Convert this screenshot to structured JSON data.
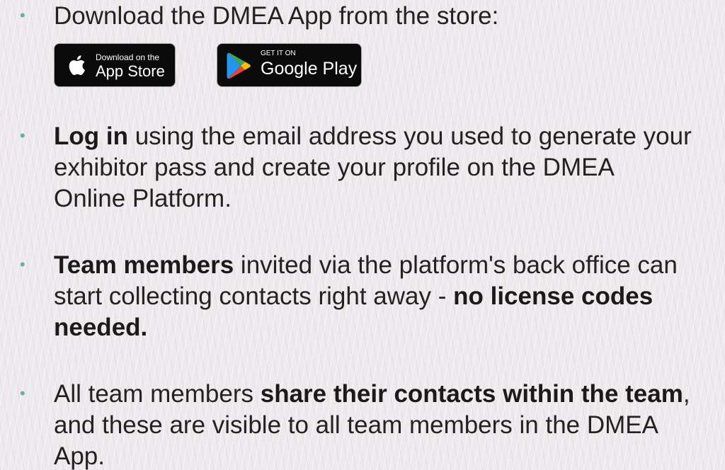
{
  "bullets": [
    {
      "parts": [
        "Download the DMEA App from the store:"
      ]
    },
    {
      "line1_bold": "Log in",
      "line1_rest": " using the email address you used to generate your",
      "line2": "exhibitor pass and create your profile on the DMEA",
      "line3": "Online Platform."
    },
    {
      "line1_bold": "Team members",
      "line1_rest": " invited via the platform's back office can",
      "line2_pre": "start collecting contacts right away - ",
      "line2_bold": "no license codes",
      "line3_bold": "needed."
    },
    {
      "line1_pre": "All team members ",
      "line1_bold": "share their contacts within the team",
      "line1_post": ",",
      "line2": "and these are visible to all team members in the DMEA",
      "line3": "App."
    }
  ],
  "badges": {
    "apple": {
      "small": "Download on the",
      "big": "App Store",
      "icon": "apple-logo-icon"
    },
    "google": {
      "small": "GET IT ON",
      "big": "Google Play",
      "icon": "google-play-logo-icon"
    }
  },
  "colors": {
    "bullet": "#5ab5a5",
    "text": "#222222",
    "background": "#eee9ec",
    "badge_bg": "#0b0b0b"
  }
}
